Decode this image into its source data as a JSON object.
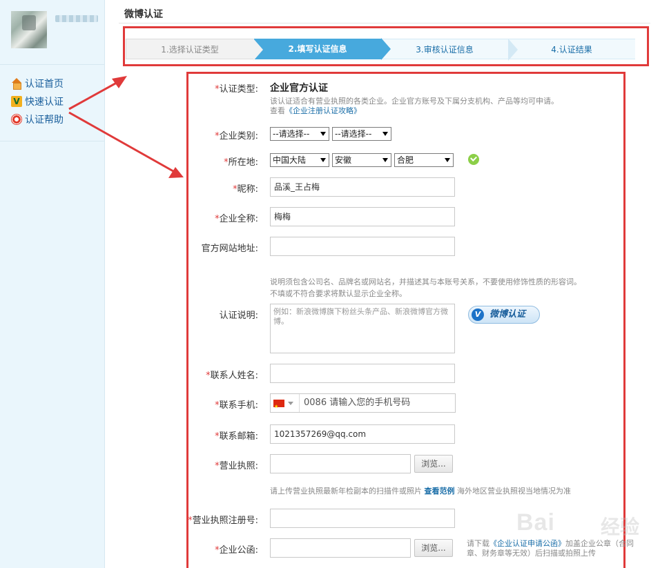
{
  "sidebar": {
    "nav": [
      {
        "label": "认证首页",
        "icon": "home-icon"
      },
      {
        "label": "快速认证",
        "icon": "quick-verify-icon"
      },
      {
        "label": "认证帮助",
        "icon": "lifebuoy-icon"
      }
    ]
  },
  "header": {
    "title": "微博认证"
  },
  "steps": [
    {
      "label": "1.选择认证类型",
      "state": "done"
    },
    {
      "label": "2.填写认证信息",
      "state": "active"
    },
    {
      "label": "3.审核认证信息",
      "state": "pending"
    },
    {
      "label": "4.认证结果",
      "state": "pending"
    }
  ],
  "form": {
    "type": {
      "label": "认证类型:",
      "value": "企业官方认证",
      "hint": "该认证适合有营业执照的各类企业。企业官方账号及下属分支机构、产品等均可申请。",
      "guide_prefix": "查看",
      "guide_link": "《企业注册认证攻略》"
    },
    "category": {
      "label": "企业类别:",
      "select1": "--请选择--",
      "select2": "--请选择--"
    },
    "location": {
      "label": "所在地:",
      "country": "中国大陆",
      "province": "安徽",
      "city": "合肥"
    },
    "nickname": {
      "label": "昵称:",
      "value": "品溪_王占梅"
    },
    "fullname": {
      "label": "企业全称:",
      "value": "梅梅"
    },
    "website": {
      "label": "官方网站地址:",
      "value": ""
    },
    "desc": {
      "label": "认证说明:",
      "hint1": "说明须包含公司名、品牌名或网站名，并描述其与本账号关系，不要使用修饰性质的形容词。",
      "hint2": "不填或不符合要求将默认显示企业全称。",
      "placeholder": "例如：新浪微博旗下粉丝头条产品、新浪微博官方微博。",
      "badge": "微博认证",
      "badge_v": "V"
    },
    "contact_name": {
      "label": "联系人姓名:",
      "value": ""
    },
    "phone": {
      "label": "联系手机:",
      "placeholder": "0086 请输入您的手机号码"
    },
    "email": {
      "label": "联系邮箱:",
      "value": "1021357269@qq.com"
    },
    "license": {
      "label": "营业执照:",
      "browse": "浏览...",
      "hint_prefix": "请上传营业执照最新年检副本的扫描件或照片",
      "hint_link": "查看范例",
      "hint_suffix": "海外地区营业执照视当地情况为准"
    },
    "license_no": {
      "label": "营业执照注册号:",
      "value": ""
    },
    "letter": {
      "label": "企业公函:",
      "browse": "浏览...",
      "hint_prefix": "请下载",
      "hint_link": "《企业认证申请公函》",
      "hint_suffix": "加盖企业公章（合同章、财务章等无效）后扫描或拍照上传"
    }
  },
  "required_mark": "*",
  "watermark": {
    "text": "Bai",
    "cn": "经验"
  },
  "colors": {
    "accent": "#47a9dd",
    "annotation": "#e03a3a",
    "link": "#1a6ea8"
  }
}
